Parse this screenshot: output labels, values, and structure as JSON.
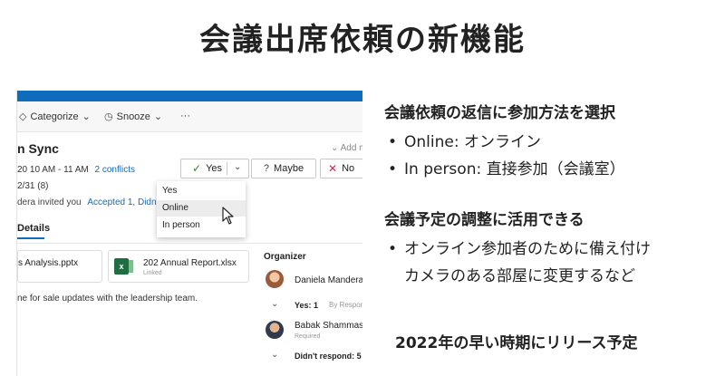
{
  "slide": {
    "title": "会議出席依頼の新機能",
    "section1": {
      "heading": "会議依頼の返信に参加方法を選択",
      "bullets": [
        "Online: オンライン",
        "In person: 直接参加（会議室）"
      ]
    },
    "section2": {
      "heading": "会議予定の調整に活用できる",
      "bullet_line1": "オンライン参加者のために備え付け",
      "bullet_line2": "カメラのある部屋に変更するなど"
    },
    "release_note": "2022年の早い時期にリリース予定"
  },
  "outlook": {
    "toolbar": {
      "categorize": "Categorize",
      "snooze": "Snooze",
      "more": "···"
    },
    "meeting": {
      "subject": "n Sync",
      "add_link": "Add m",
      "time": "20 10 AM - 11 AM",
      "conflicts": "2 conflicts",
      "date": "2/31 (8)",
      "invited_by": "dera invited you",
      "accepted": "Accepted 1, Didn't"
    },
    "rsvp": {
      "yes": "Yes",
      "maybe": "Maybe",
      "no": "No"
    },
    "dropdown": {
      "items": [
        "Yes",
        "Online",
        "In person"
      ],
      "highlighted": "Online"
    },
    "tab": "Details",
    "attachments": [
      {
        "name": "s Analysis.pptx"
      },
      {
        "name": "202 Annual Report.xlsx",
        "sub": "Linked"
      }
    ],
    "body_text": "ne for sale updates with the leadership team.",
    "attendees": {
      "organizer_label": "Organizer",
      "organizer_name": "Daniela Mandera",
      "yes_count": "Yes: 1",
      "by_response": "By Respon",
      "attendee_name": "Babak Shammas",
      "attendee_role": "Required",
      "didnt_respond": "Didn't respond: 5"
    }
  }
}
